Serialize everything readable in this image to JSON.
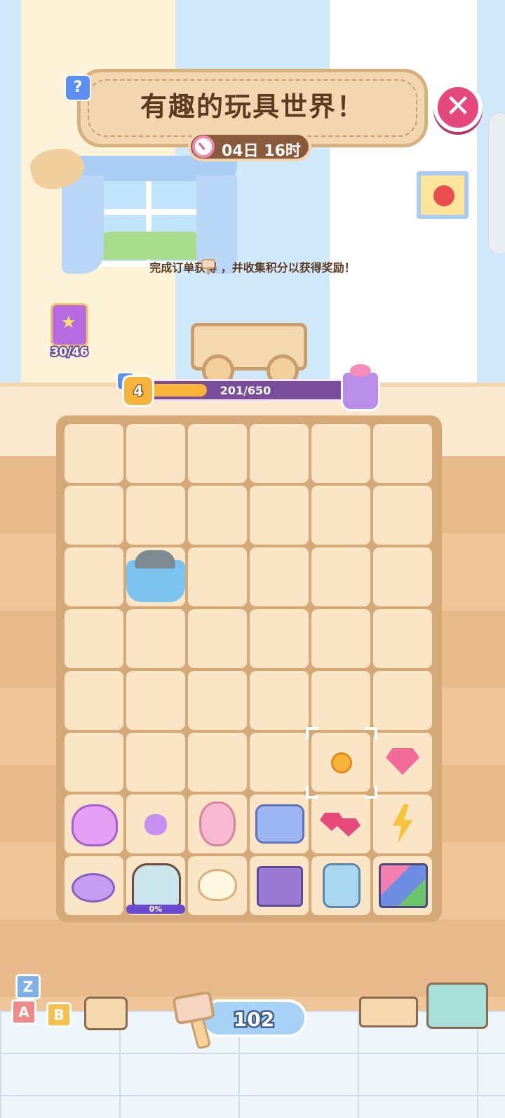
{
  "event": {
    "title": "有趣的玩具世界！",
    "timer": "04日 16时",
    "instruction": "完成订单获得      ，并收集积分以获得奖励！"
  },
  "help_label": "?",
  "close_label": "✕",
  "album": {
    "count": "30/46"
  },
  "progress": {
    "level": "4",
    "text": "201/650",
    "fraction": 0.309
  },
  "board": {
    "rows": 8,
    "cols": 6,
    "items": [
      {
        "row": 2,
        "col": 1,
        "type": "bathtub",
        "name": "bathtub-toy"
      },
      {
        "row": 5,
        "col": 4,
        "type": "coin",
        "name": "energy-coin"
      },
      {
        "row": 5,
        "col": 5,
        "type": "gem",
        "name": "pink-gem"
      },
      {
        "row": 6,
        "col": 0,
        "type": "purse",
        "name": "purple-purse"
      },
      {
        "row": 6,
        "col": 1,
        "type": "pebble",
        "name": "purple-pebble"
      },
      {
        "row": 6,
        "col": 2,
        "type": "teddy",
        "name": "pink-teddy-bear"
      },
      {
        "row": 6,
        "col": 3,
        "type": "train",
        "name": "toy-train"
      },
      {
        "row": 6,
        "col": 4,
        "type": "gems2",
        "name": "red-gems"
      },
      {
        "row": 6,
        "col": 5,
        "type": "bolt",
        "name": "lightning-bolt"
      },
      {
        "row": 7,
        "col": 0,
        "type": "disc",
        "name": "purple-coin-stack"
      },
      {
        "row": 7,
        "col": 1,
        "type": "chest",
        "name": "toy-chest"
      },
      {
        "row": 7,
        "col": 2,
        "type": "duck",
        "name": "rubber-duck"
      },
      {
        "row": 7,
        "col": 3,
        "type": "bricks",
        "name": "purple-bricks"
      },
      {
        "row": 7,
        "col": 4,
        "type": "robot",
        "name": "toy-robot"
      },
      {
        "row": 7,
        "col": 5,
        "type": "bricks2",
        "name": "lego-bricks"
      }
    ],
    "selected": {
      "row": 5,
      "col": 4
    },
    "chest_progress": "0%"
  },
  "bottom": {
    "points": "102",
    "blocks": [
      {
        "letter": "Z",
        "color": "#7fb0e8"
      },
      {
        "letter": "A",
        "color": "#f08a8a"
      },
      {
        "letter": "B",
        "color": "#f6c04a"
      }
    ]
  }
}
